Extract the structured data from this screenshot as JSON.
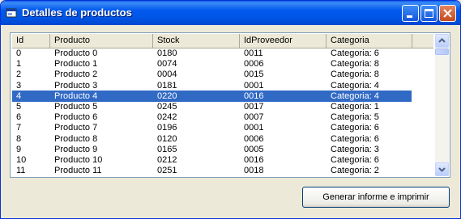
{
  "window": {
    "title": "Detalles de productos",
    "icon": "app-window-icon",
    "controls": [
      "minimize-icon",
      "maximize-icon",
      "close-icon"
    ]
  },
  "table": {
    "columns": [
      "Id",
      "Producto",
      "Stock",
      "IdProveedor",
      "Categoria"
    ],
    "selected_index": 4,
    "rows": [
      [
        "0",
        "Producto 0",
        "0180",
        "0011",
        "Categoria: 6"
      ],
      [
        "1",
        "Producto 1",
        "0074",
        "0006",
        "Categoria: 8"
      ],
      [
        "2",
        "Producto 2",
        "0004",
        "0015",
        "Categoria: 8"
      ],
      [
        "3",
        "Producto 3",
        "0181",
        "0001",
        "Categoria: 4"
      ],
      [
        "4",
        "Producto 4",
        "0220",
        "0016",
        "Categoria: 4"
      ],
      [
        "5",
        "Producto 5",
        "0245",
        "0017",
        "Categoria: 1"
      ],
      [
        "6",
        "Producto 6",
        "0242",
        "0007",
        "Categoria: 5"
      ],
      [
        "7",
        "Producto 7",
        "0196",
        "0001",
        "Categoria: 6"
      ],
      [
        "8",
        "Producto 8",
        "0120",
        "0006",
        "Categoria: 6"
      ],
      [
        "9",
        "Producto 9",
        "0165",
        "0005",
        "Categoria: 3"
      ],
      [
        "10",
        "Producto 10",
        "0212",
        "0016",
        "Categoria: 6"
      ],
      [
        "11",
        "Producto 11",
        "0251",
        "0018",
        "Categoria: 2"
      ]
    ]
  },
  "actions": {
    "report_button": "Generar informe e imprimir"
  },
  "colors": {
    "titlebar": "#0055E5",
    "selection": "#316AC5",
    "face": "#ECE9D8"
  }
}
